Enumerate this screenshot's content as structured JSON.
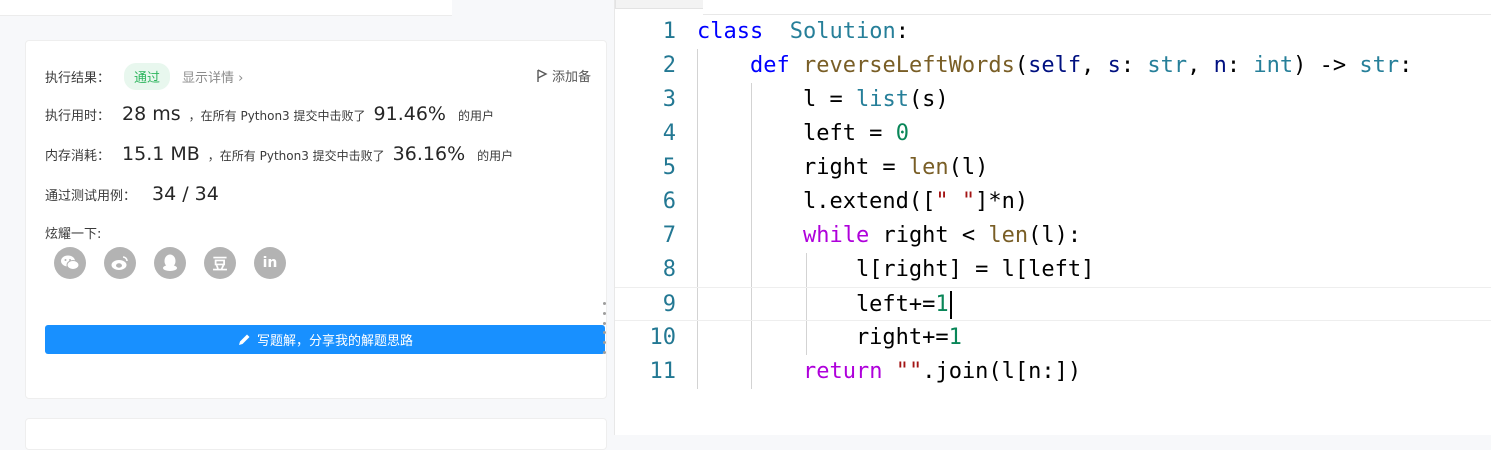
{
  "result_panel": {
    "exec_result_label": "执行结果：",
    "status_badge": "通过",
    "show_details": "显示详情 ›",
    "add_note": "添加备",
    "runtime": {
      "label": "执行用时：",
      "value": "28 ms",
      "text": "，在所有 Python3 提交中击败了",
      "percent": "91.46%",
      "suffix": "的用户"
    },
    "memory": {
      "label": "内存消耗：",
      "value": "15.1 MB",
      "text": "，在所有 Python3 提交中击败了",
      "percent": "36.16%",
      "suffix": "的用户"
    },
    "testcases": {
      "label": "通过测试用例：",
      "value": "34 / 34"
    },
    "share_label": "炫耀一下:",
    "share_icons": [
      "wechat-icon",
      "weibo-icon",
      "qq-icon",
      "douban-icon",
      "linkedin-icon"
    ],
    "douban_glyph": "豆",
    "linkedin_glyph": "in",
    "write_solution_button": "写题解，分享我的解题思路"
  },
  "editor": {
    "current_line": 9,
    "lines": [
      {
        "n": "1",
        "tokens": [
          [
            "kw",
            "class"
          ],
          [
            "",
            "  "
          ],
          [
            "cls",
            "Solution"
          ],
          [
            "",
            ":"
          ]
        ]
      },
      {
        "n": "2",
        "tokens": [
          [
            "",
            "    "
          ],
          [
            "kw",
            "def"
          ],
          [
            "",
            " "
          ],
          [
            "fn",
            "reverseLeftWords"
          ],
          [
            "",
            "("
          ],
          [
            "prm",
            "self"
          ],
          [
            "",
            ", "
          ],
          [
            "prm",
            "s"
          ],
          [
            "",
            ": "
          ],
          [
            "cls",
            "str"
          ],
          [
            "",
            ", "
          ],
          [
            "prm",
            "n"
          ],
          [
            "",
            ": "
          ],
          [
            "cls",
            "int"
          ],
          [
            "",
            ") -> "
          ],
          [
            "cls",
            "str"
          ],
          [
            "",
            ":"
          ]
        ]
      },
      {
        "n": "3",
        "tokens": [
          [
            "",
            "        l = "
          ],
          [
            "cls",
            "list"
          ],
          [
            "",
            "(s)"
          ]
        ]
      },
      {
        "n": "4",
        "tokens": [
          [
            "",
            "        left = "
          ],
          [
            "num",
            "0"
          ]
        ]
      },
      {
        "n": "5",
        "tokens": [
          [
            "",
            "        right = "
          ],
          [
            "fn",
            "len"
          ],
          [
            "",
            "(l)"
          ]
        ]
      },
      {
        "n": "6",
        "tokens": [
          [
            "",
            "        l.extend(["
          ],
          [
            "str",
            "\" \""
          ],
          [
            "",
            "]*n)"
          ]
        ]
      },
      {
        "n": "7",
        "tokens": [
          [
            "",
            "        "
          ],
          [
            "kw2",
            "while"
          ],
          [
            "",
            " right < "
          ],
          [
            "fn",
            "len"
          ],
          [
            "",
            "(l):"
          ]
        ]
      },
      {
        "n": "8",
        "tokens": [
          [
            "",
            "            l[right] = l[left]"
          ]
        ]
      },
      {
        "n": "9",
        "tokens": [
          [
            "",
            "            left+="
          ],
          [
            "num",
            "1"
          ]
        ]
      },
      {
        "n": "10",
        "tokens": [
          [
            "",
            "            right+="
          ],
          [
            "num",
            "1"
          ]
        ]
      },
      {
        "n": "11",
        "tokens": [
          [
            "",
            "        "
          ],
          [
            "kw2",
            "return"
          ],
          [
            "",
            " "
          ],
          [
            "str",
            "\"\""
          ],
          [
            "",
            ".join(l[n:])"
          ]
        ]
      }
    ]
  },
  "colors": {
    "accent": "#1890ff",
    "pass_green": "#2db55d",
    "keyword": "#0000ff",
    "control_keyword": "#af00db",
    "type": "#267f99",
    "function": "#795e26",
    "number": "#098658",
    "string": "#a31515",
    "line_number": "#237893"
  }
}
